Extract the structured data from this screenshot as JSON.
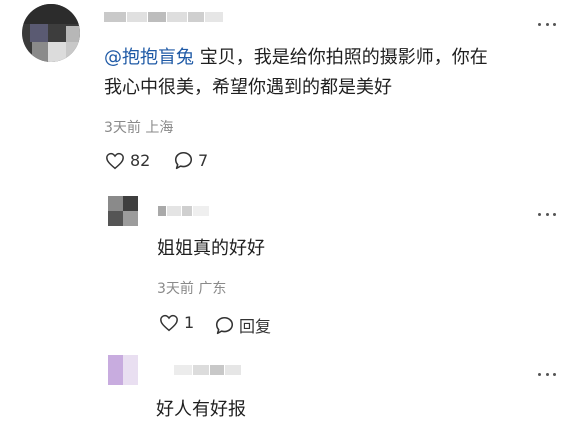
{
  "comment1": {
    "mention": "@抱抱盲兔",
    "text_line1": " 宝贝，我是给你拍照的摄影师，你在",
    "text_line2": "我心中很美，希望你遇到的都是美好",
    "time": "3天前",
    "location": "上海",
    "likes": "82",
    "replies": "7"
  },
  "reply1": {
    "text": "姐姐真的好好",
    "time": "3天前",
    "location": "广东",
    "likes": "1",
    "reply_label": "回复"
  },
  "reply2": {
    "text": "好人有好报"
  },
  "icons": {
    "more": "more-icon",
    "like": "heart-outline-icon",
    "comment": "comment-bubble-icon"
  }
}
